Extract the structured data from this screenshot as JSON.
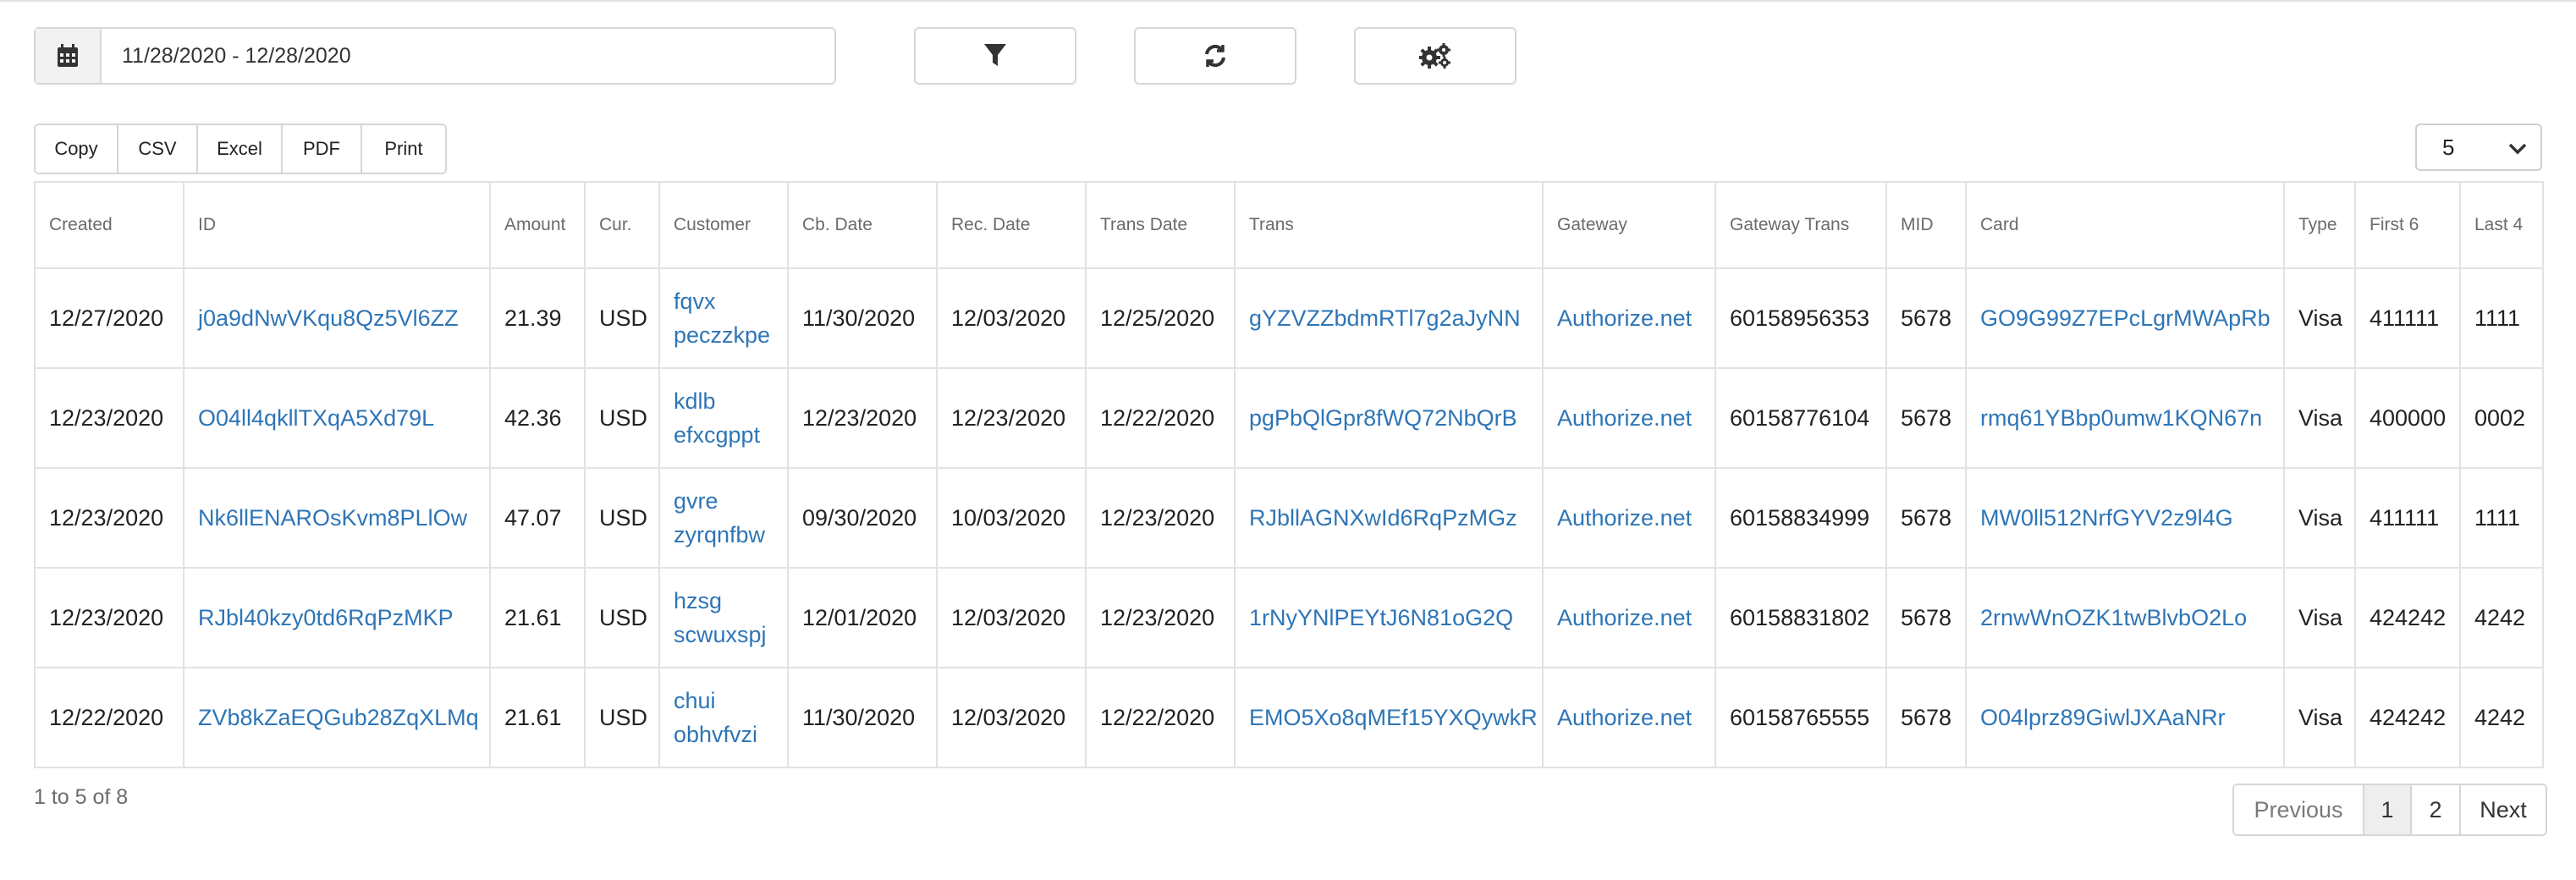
{
  "toolbar": {
    "date_range": "11/28/2020 - 12/28/2020",
    "filter_icon": "filter-icon",
    "refresh_icon": "refresh-icon",
    "settings_icon": "cogs-icon",
    "calendar_icon": "calendar-icon"
  },
  "export_buttons": [
    "Copy",
    "CSV",
    "Excel",
    "PDF",
    "Print"
  ],
  "page_length": "5",
  "table": {
    "headers": [
      "Created",
      "ID",
      "Amount",
      "Cur.",
      "Customer",
      "Cb. Date",
      "Rec. Date",
      "Trans Date",
      "Trans",
      "Gateway",
      "Gateway Trans",
      "MID",
      "Card",
      "Type",
      "First 6",
      "Last 4"
    ],
    "rows": [
      [
        "12/27/2020",
        "j0a9dNwVKqu8Qz5Vl6ZZ",
        "21.39",
        "USD",
        "fqvx peczzkpe",
        "11/30/2020",
        "12/03/2020",
        "12/25/2020",
        "gYZVZZbdmRTl7g2aJyNN",
        "Authorize.net",
        "60158956353",
        "5678",
        "GO9G99Z7EPcLgrMWApRb",
        "Visa",
        "411111",
        "1111"
      ],
      [
        "12/23/2020",
        "O04ll4qkllTXqA5Xd79L",
        "42.36",
        "USD",
        "kdlb efxcgppt",
        "12/23/2020",
        "12/23/2020",
        "12/22/2020",
        "pgPbQlGpr8fWQ72NbQrB",
        "Authorize.net",
        "60158776104",
        "5678",
        "rmq61YBbp0umw1KQN67n",
        "Visa",
        "400000",
        "0002"
      ],
      [
        "12/23/2020",
        "Nk6llENAROsKvm8PLlOw",
        "47.07",
        "USD",
        "gvre zyrqnfbw",
        "09/30/2020",
        "10/03/2020",
        "12/23/2020",
        "RJbllAGNXwId6RqPzMGz",
        "Authorize.net",
        "60158834999",
        "5678",
        "MW0ll512NrfGYV2z9l4G",
        "Visa",
        "411111",
        "1111"
      ],
      [
        "12/23/2020",
        "RJbl40kzy0td6RqPzMKP",
        "21.61",
        "USD",
        "hzsg scwuxspj",
        "12/01/2020",
        "12/03/2020",
        "12/23/2020",
        "1rNyYNlPEYtJ6N81oG2Q",
        "Authorize.net",
        "60158831802",
        "5678",
        "2rnwWnOZK1twBlvbO2Lo",
        "Visa",
        "424242",
        "4242"
      ],
      [
        "12/22/2020",
        "ZVb8kZaEQGub28ZqXLMq",
        "21.61",
        "USD",
        "chui obhvfvzi",
        "11/30/2020",
        "12/03/2020",
        "12/22/2020",
        "EMO5Xo8qMEf15YXQywkR",
        "Authorize.net",
        "60158765555",
        "5678",
        "O04lprz89GiwlJXAaNRr",
        "Visa",
        "424242",
        "4242"
      ]
    ]
  },
  "info": "1 to 5 of 8",
  "pagination": {
    "previous": "Previous",
    "pages": [
      "1",
      "2"
    ],
    "next": "Next",
    "current": "1"
  },
  "colors": {
    "link": "#2e75b6",
    "border": "#e2e2e2",
    "muted": "#6b6b6b"
  }
}
